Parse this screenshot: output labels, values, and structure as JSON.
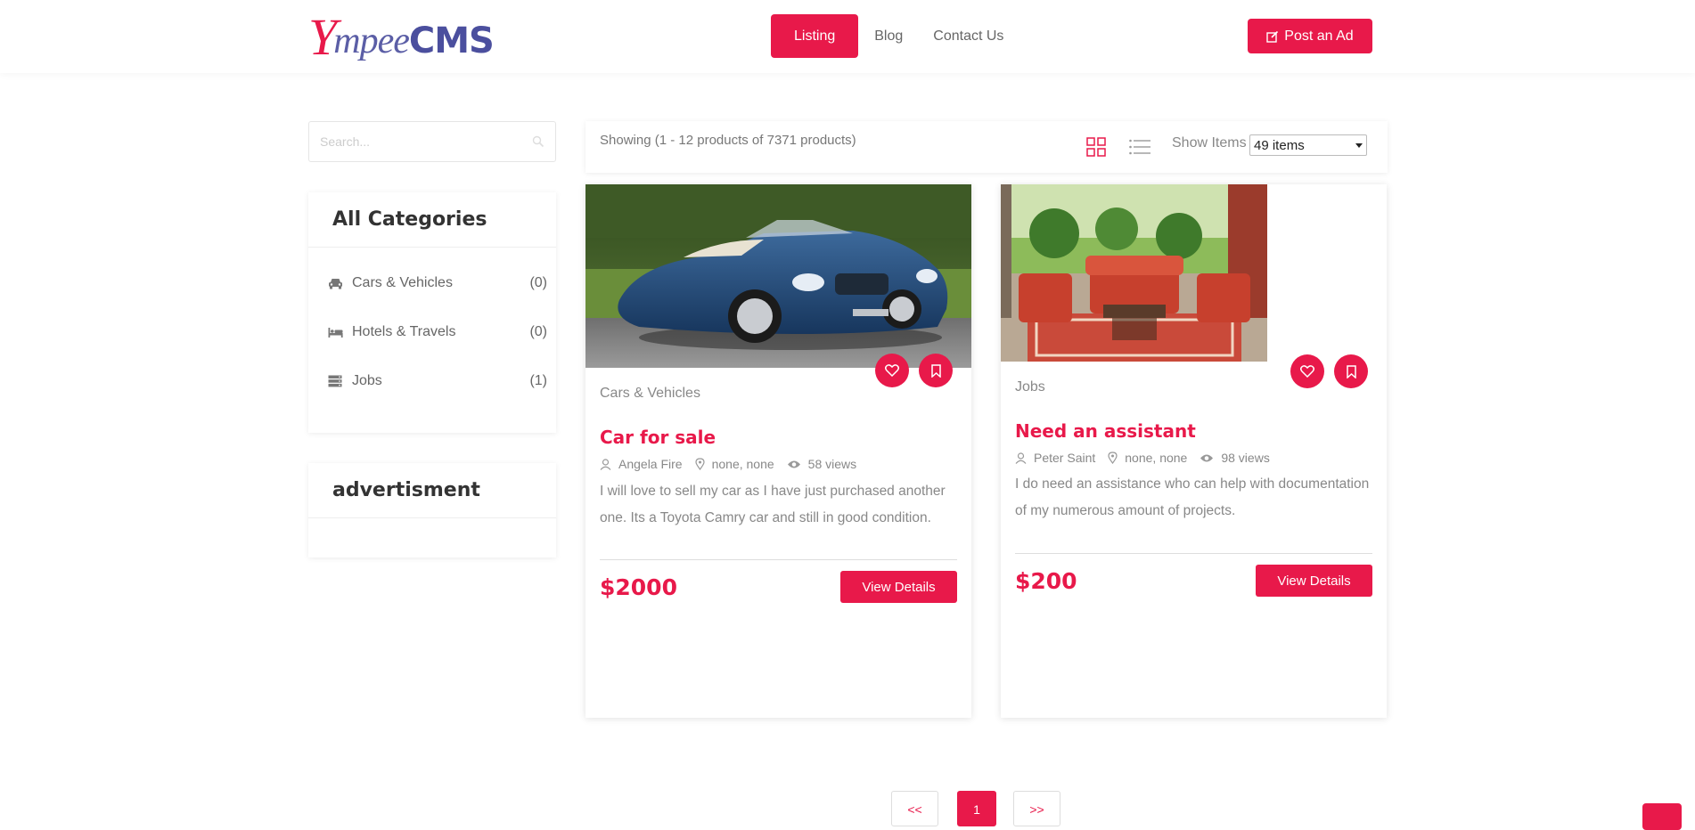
{
  "brand": {
    "logo_y": "Y",
    "logo_mpee": "mpee",
    "logo_cms": "CMS"
  },
  "nav": {
    "items": [
      {
        "label": "Listing"
      },
      {
        "label": "Blog"
      },
      {
        "label": "Contact Us"
      }
    ],
    "post_ad_label": "Post an Ad"
  },
  "search": {
    "placeholder": "Search..."
  },
  "categories": {
    "title": "All Categories",
    "items": [
      {
        "label": "Cars & Vehicles",
        "count": "(0)",
        "icon": "car-icon"
      },
      {
        "label": "Hotels & Travels",
        "count": "(0)",
        "icon": "bed-icon"
      },
      {
        "label": "Jobs",
        "count": "(1)",
        "icon": "server-icon"
      }
    ]
  },
  "advertisment": {
    "title": "advertisment"
  },
  "toolbar": {
    "showing": "Showing (1 - 12 products of 7371 products)",
    "show_items_label": "Show Items",
    "items_selected": "49 items"
  },
  "listings": [
    {
      "category": "Cars & Vehicles",
      "title": "Car for sale",
      "author": "Angela Fire",
      "location": "none, none",
      "views": "58 views",
      "description": "I will love to sell my car as I have just purchased another one. Its a Toyota Camry car and still in good condition.",
      "price": "$2000",
      "button": "View Details"
    },
    {
      "category": "Jobs",
      "title": "Need an assistant",
      "author": "Peter Saint",
      "location": "none, none",
      "views": "98 views",
      "description": "I do need an assistance who can help with documentation of my numerous amount of projects.",
      "price": "$200",
      "button": "View Details"
    }
  ],
  "pagination": {
    "prev": "<<",
    "current": "1",
    "next": ">>"
  },
  "colors": {
    "accent": "#e8194a",
    "logo_blue": "#4b4f9e"
  }
}
